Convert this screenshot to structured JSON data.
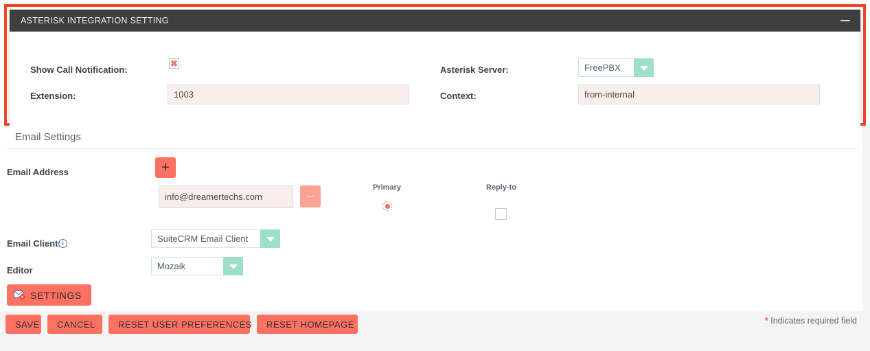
{
  "asterisk_panel": {
    "title": "ASTERISK INTEGRATION SETTING",
    "collapse_icon": "minus-icon",
    "highlight_color": "#f0432c",
    "header_bg": "#3e3e3e",
    "fields": {
      "show_call_notification": {
        "label": "Show Call Notification:",
        "checkbox_state": "x-marked",
        "mark": "✖"
      },
      "extension": {
        "label": "Extension:",
        "value": "1003"
      },
      "asterisk_server": {
        "label": "Asterisk Server:",
        "value": "FreePBX",
        "options": [
          "FreePBX"
        ]
      },
      "context": {
        "label": "Context:",
        "value": "from-internal"
      }
    }
  },
  "email_settings": {
    "section_title": "Email Settings",
    "email_address": {
      "label": "Email Address",
      "add_button_icon": "plus-icon",
      "add_button_label": "+",
      "rows": [
        {
          "value": "info@dreamertechs.com",
          "remove_button_label": "−",
          "remove_button_icon": "minus-icon",
          "primary_selected": true,
          "reply_to_checked": false
        }
      ],
      "columns": {
        "primary": "Primary",
        "reply_to": "Reply-to"
      }
    },
    "email_client": {
      "label": "Email Client:",
      "info_icon": "info-icon",
      "info_glyph": "i",
      "value": "SuiteCRM Email Client",
      "options": [
        "SuiteCRM Email Client"
      ]
    },
    "editor": {
      "label": "Editor",
      "value": "Mozaik",
      "options": [
        "Mozaik"
      ]
    },
    "settings_button": {
      "label": "SETTINGS",
      "icon": "envelope-gear-icon"
    }
  },
  "footer": {
    "buttons": [
      {
        "label": "SAVE",
        "name": "save-button"
      },
      {
        "label": "CANCEL",
        "name": "cancel-button"
      },
      {
        "label": "RESET USER PREFERENCES",
        "name": "reset-user-preferences-button"
      },
      {
        "label": "RESET HOMEPAGE",
        "name": "reset-homepage-button"
      }
    ],
    "required_note_star": "*",
    "required_note_text": "Indicates required field"
  },
  "colors": {
    "accent_salmon": "#fc7162",
    "accent_salmon_light": "#fba294",
    "dropdown_teal": "#9de0c9",
    "field_bg": "#faeeec",
    "highlight_red": "#f0432c"
  }
}
